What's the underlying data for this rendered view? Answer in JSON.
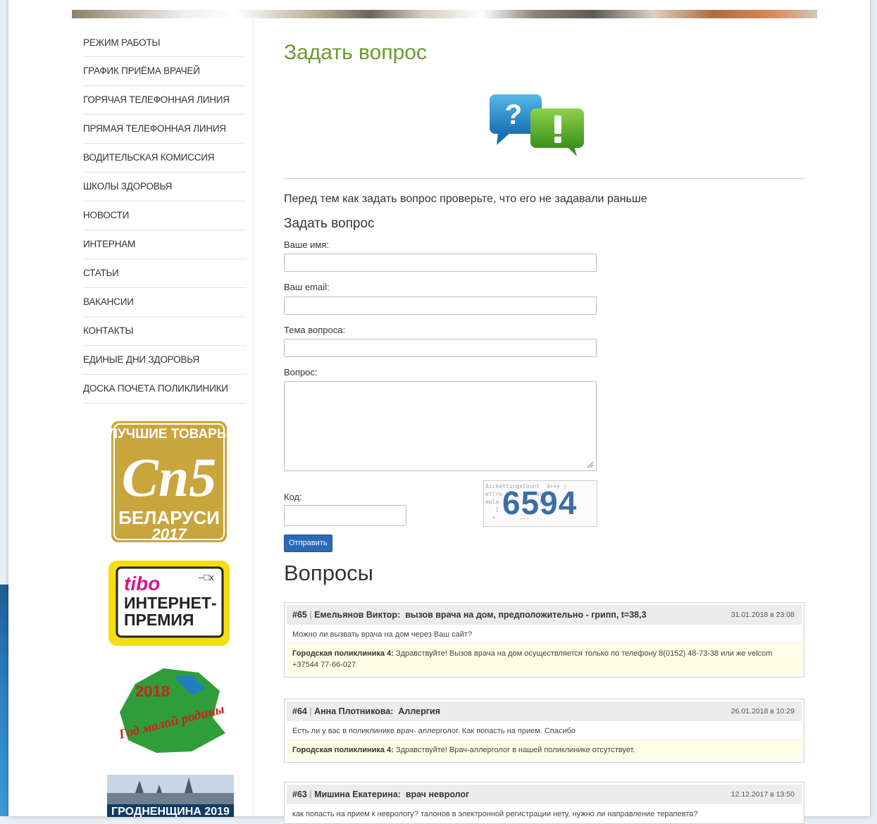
{
  "sidebar": {
    "menu": [
      "РЕЖИМ РАБОТЫ",
      "ГРАФИК ПРИЁМА ВРАЧЕЙ",
      "ГОРЯЧАЯ ТЕЛЕФОННАЯ ЛИНИЯ",
      "ПРЯМАЯ ТЕЛЕФОННАЯ ЛИНИЯ",
      "ВОДИТЕЛЬСКАЯ КОМИССИЯ",
      "ШКОЛЫ ЗДОРОВЬЯ",
      "НОВОСТИ",
      "ИНТЕРНАМ",
      "СТАТЬИ",
      "ВАКАНСИИ",
      "КОНТАКТЫ",
      "ЕДИНЫЕ ДНИ ЗДОРОВЬЯ",
      "ДОСКА ПОЧЕТА ПОЛИКЛИНИКИ"
    ],
    "badges": {
      "best_goods": {
        "line1": "ЛУЧШИЕ ТОВАРЫ",
        "line2": "БЕЛАРУСИ",
        "year": "2017"
      },
      "tibo": {
        "brand": "tibo",
        "line1": "ИНТЕРНЕТ-",
        "line2": "ПРЕМИЯ"
      },
      "year_badge": {
        "year": "2018",
        "text": "Год малой родины"
      },
      "city_badge": {
        "text": "ГРОДНЕНЩИНА 2019"
      }
    }
  },
  "main": {
    "title": "Задать вопрос",
    "intro": "Перед тем как задать вопрос проверьте, что его не задавали раньше",
    "form": {
      "title": "Задать вопрос",
      "name_label": "Ваше имя:",
      "email_label": "Ваш email:",
      "subject_label": "Тема вопроса:",
      "question_label": "Вопрос:",
      "code_label": "Код:",
      "captcha_code": "6594",
      "submit_label": "Отправить"
    },
    "questions_title": "Вопросы",
    "questions": [
      {
        "id": "#65",
        "author": "Емельянов Виктор:",
        "subject": "вызов врача на дом, предположительно - грипп, t=38,3",
        "date": "31.01.2018 в 23:08",
        "text": "Можно ли вызвать врача на дом через Ваш сайт?",
        "answer_author": "Городская поликлиника 4:",
        "answer": "Здравствуйте! Вызов врача на дом осуществляется только по телефону 8(0152) 48-73-38 или же velcom +37544 77-66-027"
      },
      {
        "id": "#64",
        "author": "Анна Плотникова:",
        "subject": "Аллергия",
        "date": "26.01.2018 в 10:29",
        "text": "Есть ли у вас в поликлинике врач- аллерголог. Как попасть на прием. Спасибо",
        "answer_author": "Городская поликлиника 4:",
        "answer": "Здравствуйте! Врач-аллерголог в нашей поликлинике отсутствует."
      },
      {
        "id": "#63",
        "author": "Мишина Екатерина:",
        "subject": "врач невролог",
        "date": "12.12.2017 в 13:50",
        "text": "как попасть на прием к неврологу? талонов в электронной регистрации нету, нужно ли направление терапевта?"
      }
    ]
  }
}
